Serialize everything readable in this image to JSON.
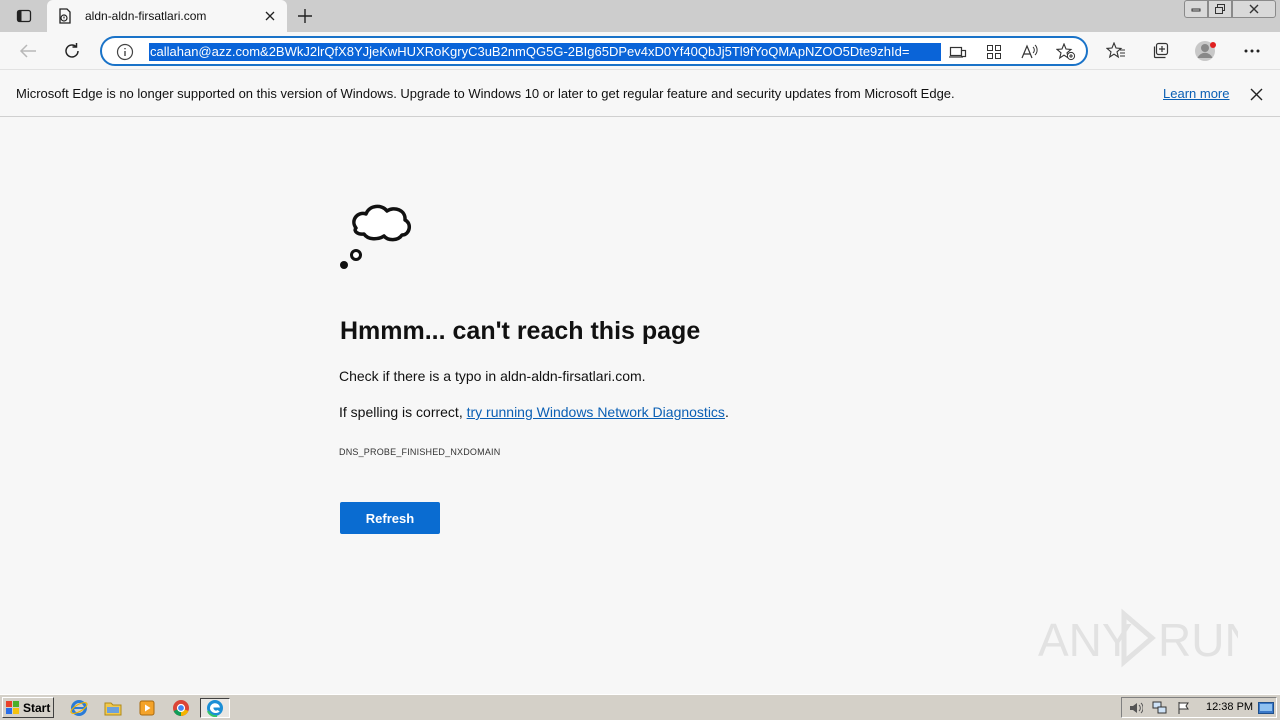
{
  "browser": {
    "tab_title": "aldn-aldn-firsatlari.com",
    "url": "callahan@azz.com&2BWkJ2lrQfX8YJjeKwHUXRoKgryC3uB2nmQG5G-2BIg65DPev4xD0Yf40QbJj5Tl9fYoQMApNZOO5Dte9zhId=",
    "icons": [
      "tab-actions-icon",
      "page-favicon",
      "close-icon",
      "plus-icon",
      "back-arrow-icon",
      "refresh-icon",
      "info-icon",
      "app-available-icon",
      "apps-grid-icon",
      "read-aloud-icon",
      "add-favorite-icon",
      "favorites-icon",
      "collections-icon",
      "profile-avatar-icon",
      "more-icon"
    ]
  },
  "infobar": {
    "message": "Microsoft Edge is no longer supported on this version of Windows. Upgrade to Windows 10 or later to get regular feature and security updates from Microsoft Edge.",
    "learn_more": "Learn more"
  },
  "error_page": {
    "title": "Hmmm... can't reach this page",
    "line1": "Check if there is a typo in aldn-aldn-firsatlari.com.",
    "line2_prefix": "If spelling is correct, ",
    "line2_link": "try running Windows Network Diagnostics",
    "line2_suffix": ".",
    "error_code": "DNS_PROBE_FINISHED_NXDOMAIN",
    "refresh_label": "Refresh"
  },
  "watermark": {
    "text": "ANY RUN"
  },
  "taskbar": {
    "start_label": "Start",
    "clock": "12:38 PM",
    "apps": [
      "internet-explorer-icon",
      "file-explorer-icon",
      "media-player-icon",
      "chrome-icon",
      "edge-icon"
    ]
  },
  "colors": {
    "accent": "#0a6cd1",
    "link": "#0a5fb4",
    "url_highlight": "#0a64d8"
  }
}
